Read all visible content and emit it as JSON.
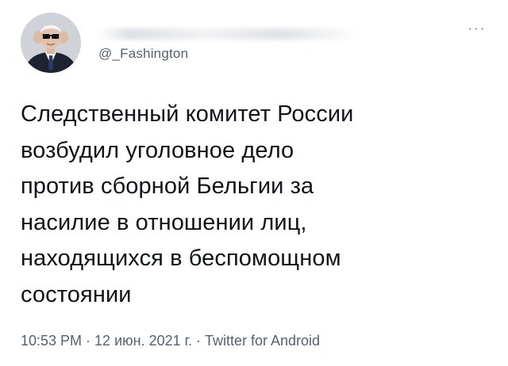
{
  "tweet": {
    "handle": "@_Fashington",
    "more_label": "···",
    "text": "Следственный комитет России\nвозбудил уголовное дело\nпротив сборной Бельгии за\nнасилие в отношении лиц,\nнаходящихся в беспомощном\nсостоянии",
    "time": "10:53 PM",
    "separator": "·",
    "date": "12 июн. 2021 г.",
    "source": "Twitter for Android"
  },
  "icons": {
    "avatar": "profile-photo-man-in-sunglasses",
    "more": "more-options-icon"
  },
  "colors": {
    "text_primary": "#0f1419",
    "text_secondary": "#536471",
    "background": "#ffffff"
  }
}
